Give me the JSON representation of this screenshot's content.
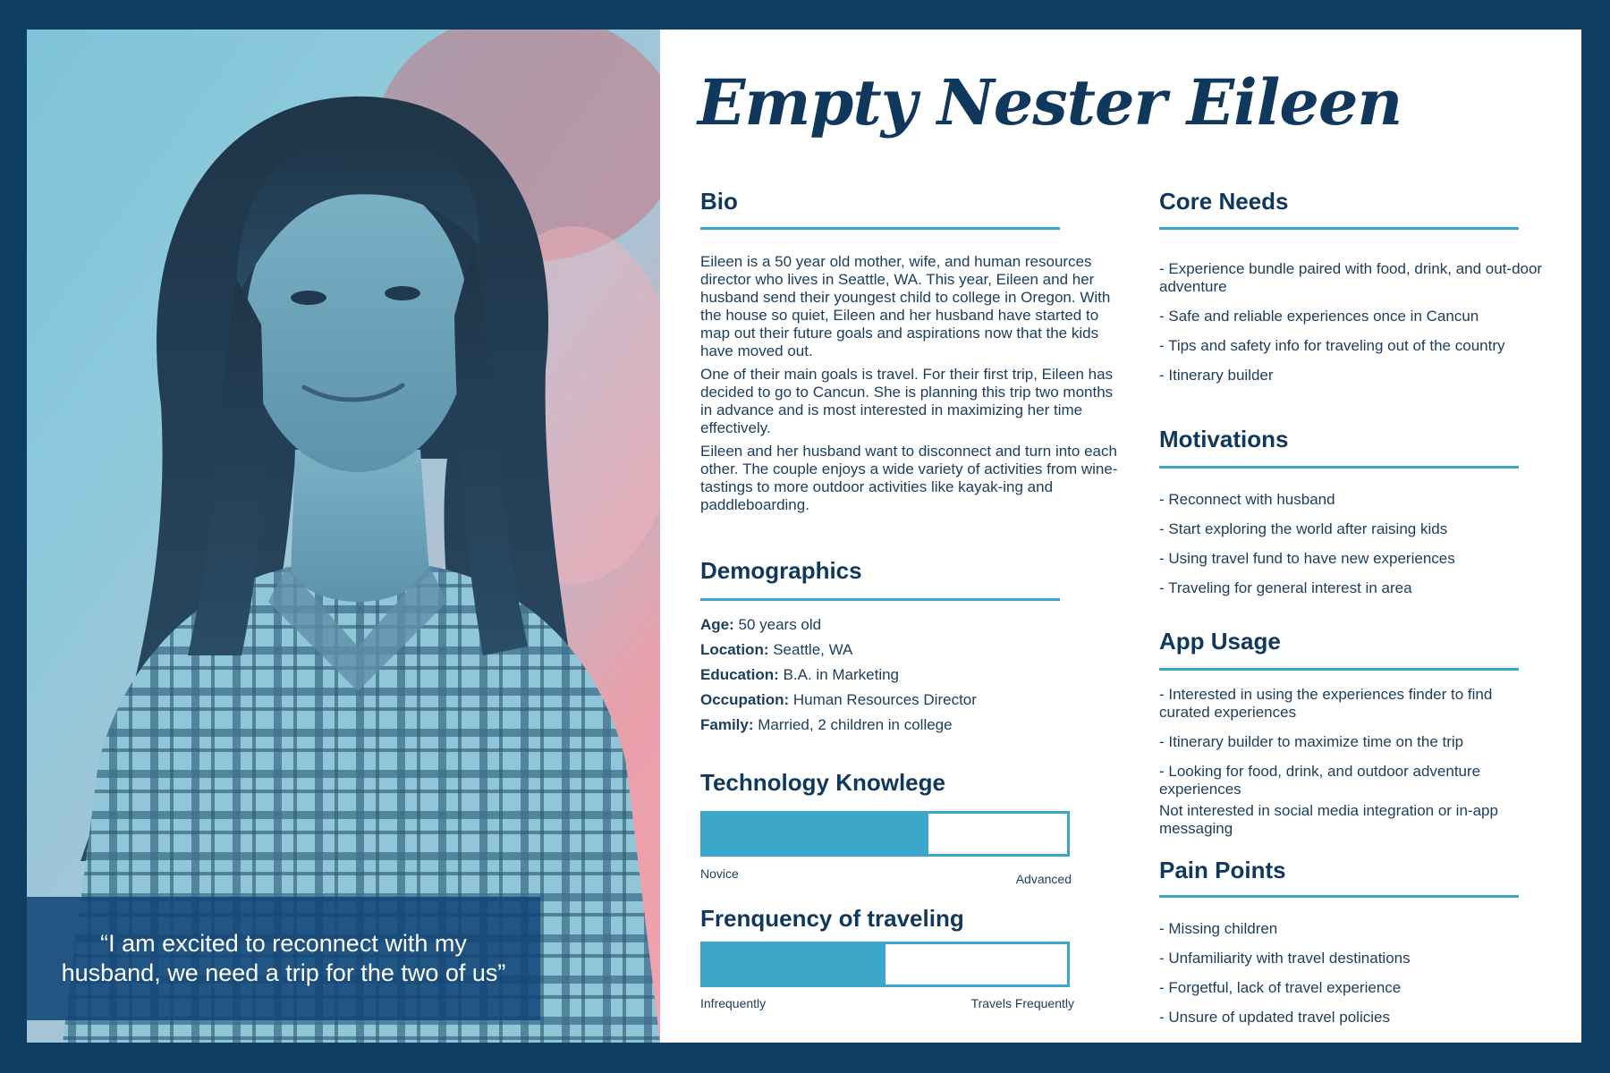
{
  "persona": {
    "name": "Empty Nester Eileen",
    "quote": "“I am excited to reconnect with my husband, we need a trip for the two of us”"
  },
  "bio": {
    "heading": "Bio",
    "paragraphs": [
      "Eileen is a 50 year old mother, wife, and human resources director who lives in Seattle, WA. This year, Eileen and her husband send their youngest child to college in Oregon. With the house so quiet, Eileen and her husband have started to map out their future goals and aspirations now that the kids have moved out.",
      "One of their main goals is travel. For their first trip, Eileen has decided to go to Cancun. She is planning this trip two months in advance and is most interested in maximizing her time effectively.",
      "Eileen and her husband want to disconnect and turn into each other. The couple enjoys a wide variety of activities from wine-tastings to more outdoor activities like kayak-ing and paddleboarding."
    ]
  },
  "demographics": {
    "heading": "Demographics",
    "items": [
      {
        "label": "Age:",
        "value": " 50 years old"
      },
      {
        "label": "Location:",
        "value": " Seattle, WA"
      },
      {
        "label": "Education:",
        "value": " B.A. in Marketing"
      },
      {
        "label": "Occupation:",
        "value": " Human Resources Director"
      },
      {
        "label": "Family:",
        "value": " Married, 2 children in college"
      }
    ]
  },
  "tech_knowledge": {
    "heading": "Technology Knowlege",
    "level": 0.62,
    "min_label": "Novice",
    "max_label": "Advanced"
  },
  "travel_frequency": {
    "heading": "Frenquency of traveling",
    "level": 0.5,
    "min_label": "Infrequently",
    "max_label": "Travels Frequently"
  },
  "core_needs": {
    "heading": "Core Needs",
    "items": [
      "- Experience bundle paired with food, drink, and out-door adventure",
      "- Safe and reliable experiences once in Cancun",
      "- Tips and safety info for traveling out of the country",
      "- Itinerary builder"
    ]
  },
  "motivations": {
    "heading": "Motivations",
    "items": [
      "- Reconnect with husband",
      "- Start exploring the world after raising kids",
      "- Using travel fund to have new experiences",
      "- Traveling for general interest in area"
    ]
  },
  "app_usage": {
    "heading": "App Usage",
    "items": [
      "- Interested in using the experiences finder to find curated experiences",
      "- Itinerary builder to maximize time on the trip",
      "- Looking for food, drink, and outdoor adventure experiences",
      "Not interested in social media integration or in-app messaging"
    ]
  },
  "pain_points": {
    "heading": "Pain Points",
    "items": [
      "- Missing children",
      "- Unfamiliarity with travel destinations",
      "- Forgetful, lack of travel experience",
      "- Unsure of updated travel policies"
    ]
  },
  "colors": {
    "background": "#0d3d63",
    "heading": "#10385c",
    "accent": "#3ba6c8",
    "quote_box": "#124676"
  }
}
